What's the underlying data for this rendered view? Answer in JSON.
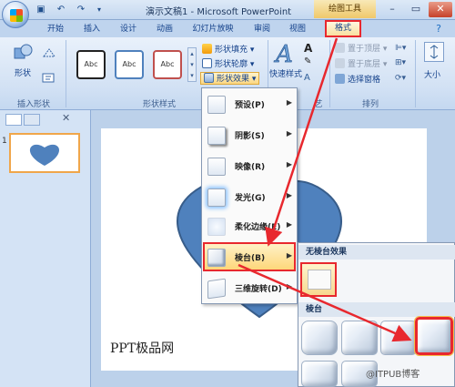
{
  "window": {
    "title": "演示文稿1 - Microsoft PowerPoint",
    "contextual_tab_group": "绘图工具"
  },
  "tabs": [
    "开始",
    "插入",
    "设计",
    "动画",
    "幻灯片放映",
    "审阅",
    "视图",
    "格式"
  ],
  "ribbon": {
    "insert_shapes": {
      "shapes_label": "形状",
      "group_label": "插入形状"
    },
    "shape_styles": {
      "style_samples": [
        "Abc",
        "Abc",
        "Abc"
      ],
      "fill_label": "形状填充",
      "outline_label": "形状轮廓",
      "effects_label": "形状效果",
      "group_label": "形状样式"
    },
    "wordart": {
      "quick_styles_label": "快速样式",
      "group_label": "艺"
    },
    "arrange": {
      "bring_front": "置于顶层",
      "send_back": "置于底层",
      "selection_pane": "选择窗格",
      "group_label": "排列"
    },
    "size": {
      "label": "大小"
    }
  },
  "effects_menu": [
    {
      "label": "预设(P)"
    },
    {
      "label": "阴影(S)"
    },
    {
      "label": "映像(R)"
    },
    {
      "label": "发光(G)"
    },
    {
      "label": "柔化边缘(E)"
    },
    {
      "label": "棱台(B)"
    },
    {
      "label": "三维旋转(D)"
    }
  ],
  "bevel_submenu": {
    "no_bevel_header": "无棱台效果",
    "bevel_header": "棱台"
  },
  "slide": {
    "thumbnail_number": "1",
    "text": "PPT极品网"
  },
  "watermark": "@ITPUB博客",
  "colors": {
    "heart_fill": "#4f81bd",
    "heart_stroke": "#385d8a",
    "highlight_red": "#e8282e",
    "hover_orange": "#fdd77a"
  }
}
